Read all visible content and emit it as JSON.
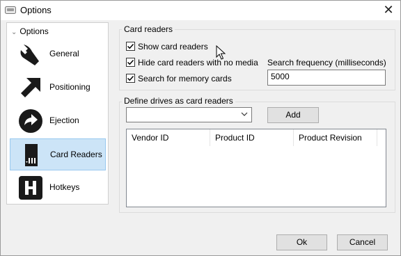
{
  "window": {
    "title": "Options",
    "close": "✕"
  },
  "sidebar": {
    "header": "Options",
    "items": [
      {
        "label": "General",
        "icon": "wrench-icon"
      },
      {
        "label": "Positioning",
        "icon": "arrow-icon"
      },
      {
        "label": "Ejection",
        "icon": "eject-arrow-icon"
      },
      {
        "label": "Card Readers",
        "icon": "sd-card-icon",
        "selected": true
      },
      {
        "label": "Hotkeys",
        "icon": "h-key-icon"
      }
    ]
  },
  "card_readers": {
    "group_title": "Card readers",
    "show_card_readers": {
      "label": "Show card readers",
      "checked": true
    },
    "hide_no_media": {
      "label": "Hide card readers with no media",
      "checked": true
    },
    "search_memory_cards": {
      "label": "Search for memory cards",
      "checked": true
    },
    "search_frequency_label": "Search frequency (milliseconds)",
    "search_frequency_value": "5000"
  },
  "define_drives": {
    "group_title": "Define drives as card readers",
    "drive_select_value": "",
    "add_label": "Add",
    "columns": [
      "Vendor ID",
      "Product ID",
      "Product Revision"
    ]
  },
  "footer": {
    "ok_label": "Ok",
    "cancel_label": "Cancel"
  }
}
